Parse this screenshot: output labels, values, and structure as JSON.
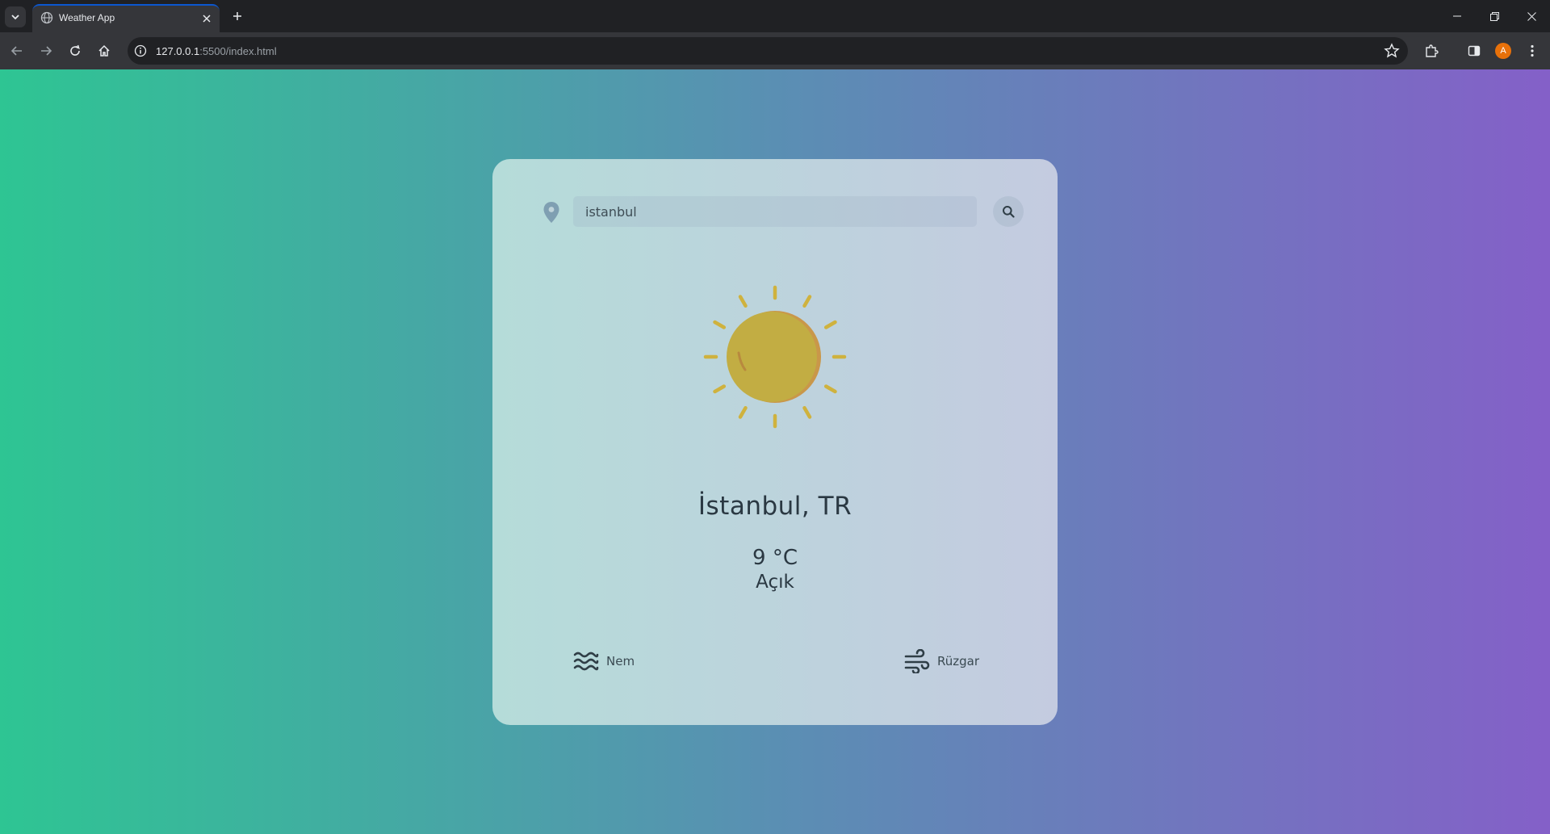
{
  "browser": {
    "tab_title": "Weather App",
    "url_host": "127.0.0.1",
    "url_rest": ":5500/index.html",
    "profile_initial": "A"
  },
  "app": {
    "search": {
      "value": "istanbul"
    },
    "weather_icon": "sun-icon",
    "city": "İstanbul, TR",
    "temperature": "9 °C",
    "description": "Açık",
    "details": {
      "humidity_label": "Nem",
      "wind_label": "Rüzgar"
    }
  },
  "colors": {
    "gradient_start": "#2ec593",
    "gradient_end": "#8460c8",
    "sun": "#c2ad43",
    "sun_shadow": "#c9974a"
  }
}
